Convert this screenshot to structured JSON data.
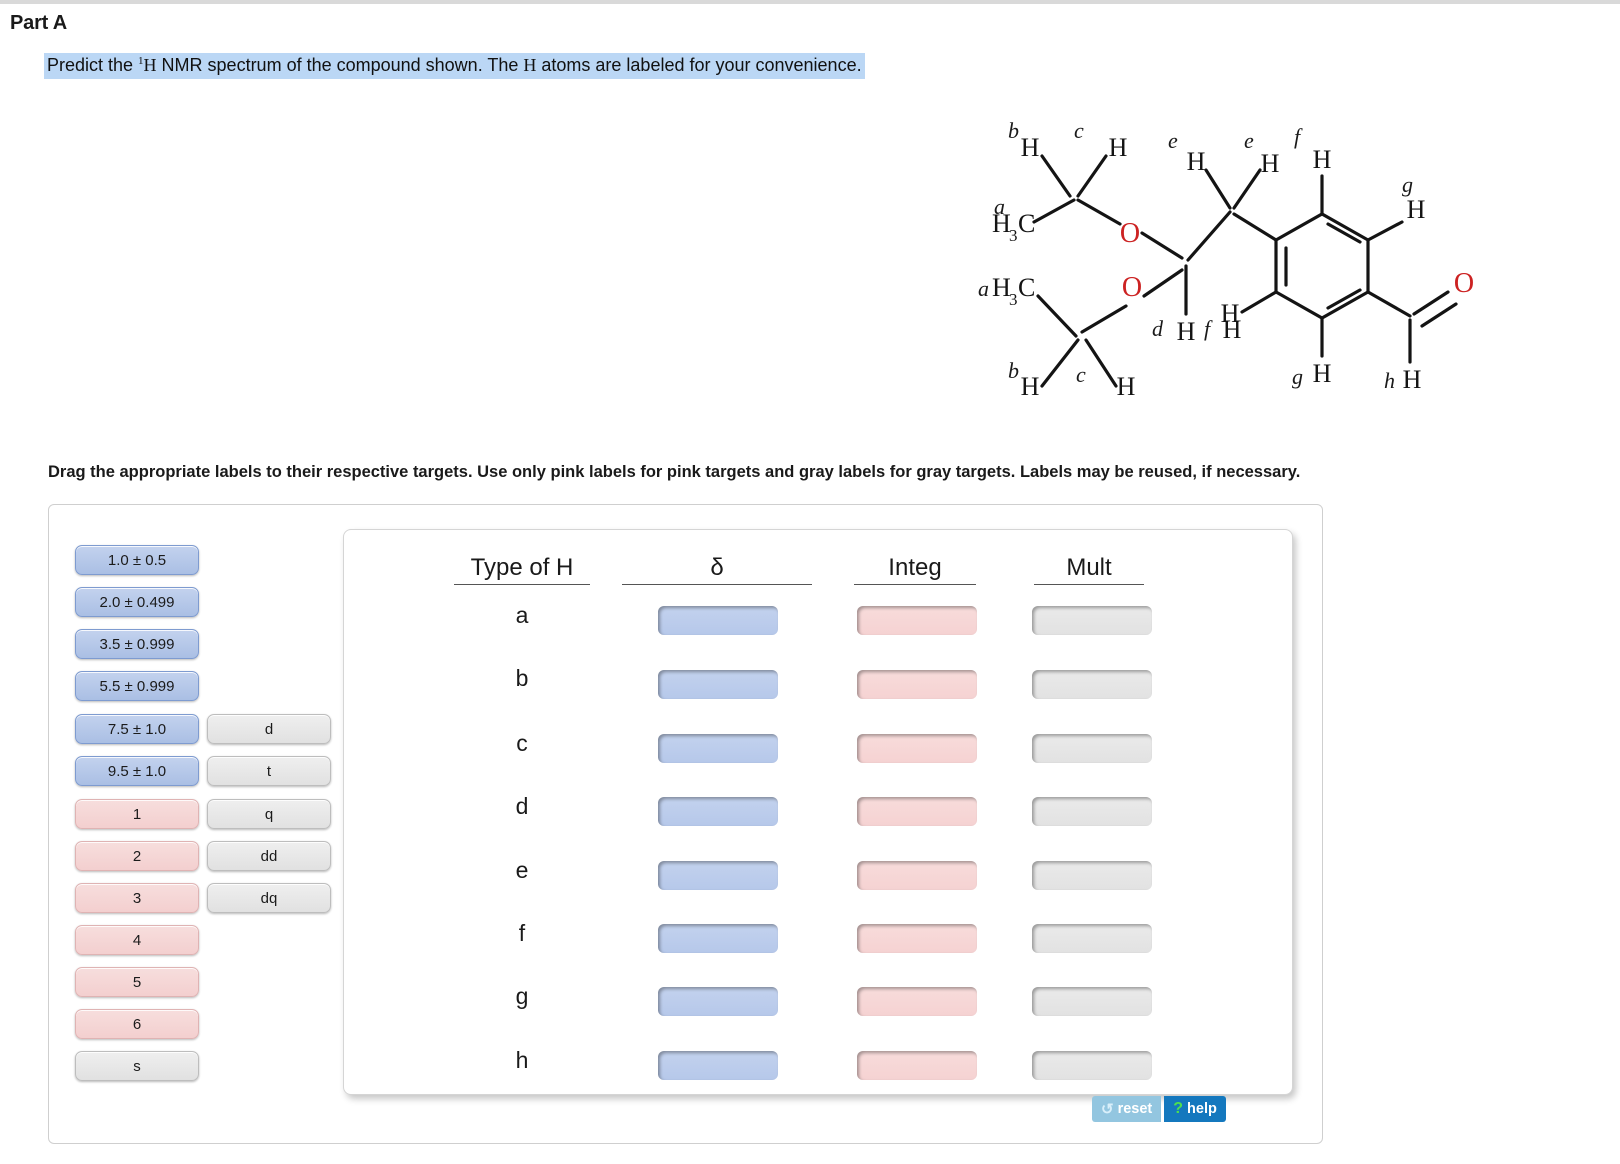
{
  "part": {
    "title": "Part A",
    "prompt_pre": "Predict the ",
    "prompt_sup": "1",
    "prompt_h": "H",
    "prompt_mid": " NMR spectrum of the compound shown. The ",
    "prompt_h2": "H",
    "prompt_post": " atoms are labeled for your convenience."
  },
  "instruction": "Drag the appropriate labels to their respective targets. Use only pink labels for pink targets and gray labels for gray targets. Labels may be reused, if necessary.",
  "molecule": {
    "atom_labels": [
      "H",
      "H",
      "H3C",
      "H3C",
      "O",
      "O",
      "H",
      "H",
      "H",
      "H",
      "H",
      "H",
      "H",
      "H",
      "H",
      "O"
    ],
    "assignment_letters": [
      "a",
      "a",
      "b",
      "b",
      "c",
      "c",
      "d",
      "e",
      "e",
      "f",
      "f",
      "g",
      "g",
      "h"
    ],
    "oxygen_color": "#cc2222",
    "bond_color": "#141414"
  },
  "shift_labels": [
    "1.0 ± 0.5",
    "2.0 ± 0.499",
    "3.5 ± 0.999",
    "5.5 ± 0.999",
    "7.5 ± 1.0",
    "9.5 ± 1.0"
  ],
  "integration_labels": [
    "1",
    "2",
    "3",
    "4",
    "5",
    "6"
  ],
  "multiplicity_labels": [
    "d",
    "t",
    "q",
    "dd",
    "dq",
    "s"
  ],
  "table": {
    "headers": [
      "Type of H",
      "δ",
      "Integ",
      "Mult"
    ],
    "rows": [
      "a",
      "b",
      "c",
      "d",
      "e",
      "f",
      "g",
      "h"
    ]
  },
  "buttons": {
    "reset_icon": "↺",
    "reset_label": "reset",
    "help_icon": "?",
    "help_label": "help"
  },
  "colors": {
    "blue_chip": "#b6c8ea",
    "pink_chip": "#f3cfcf",
    "gray_chip": "#e1e1e1",
    "highlight": "#bbd7f5",
    "help_blue": "#1478be",
    "reset_blue": "#93c6e0"
  }
}
